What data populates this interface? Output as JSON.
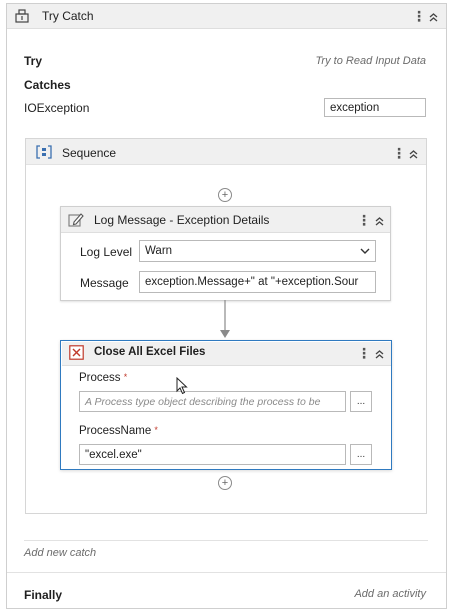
{
  "try_catch": {
    "title": "Try Catch",
    "try_label": "Try",
    "try_placeholder": "Try to Read Input Data",
    "catches_label": "Catches",
    "exception_type": "IOException",
    "exception_var": "exception",
    "add_new_catch": "Add new catch",
    "finally_label": "Finally",
    "finally_placeholder": "Add an activity"
  },
  "sequence": {
    "title": "Sequence"
  },
  "log_message": {
    "title": "Log Message - Exception Details",
    "log_level_label": "Log Level",
    "log_level_value": "Warn",
    "message_label": "Message",
    "message_value": "exception.Message+\" at \"+exception.Sour"
  },
  "close_excel": {
    "title": "Close All Excel Files",
    "process_label": "Process",
    "process_placeholder": "A Process type object describing the process to be",
    "processname_label": "ProcessName",
    "processname_value": "\"excel.exe\"",
    "browse_label": "...",
    "required_mark": "*"
  },
  "icons": {
    "try_catch": "try-catch-icon",
    "sequence": "sequence-icon",
    "log": "log-message-icon",
    "close_excel": "close-excel-icon",
    "more": "kebab-icon",
    "collapse": "collapse-icon",
    "add": "add-activity-icon"
  },
  "colors": {
    "selected_border": "#2f7ac0",
    "header_bg": "#f0f0f0",
    "required": "#c0392b"
  }
}
